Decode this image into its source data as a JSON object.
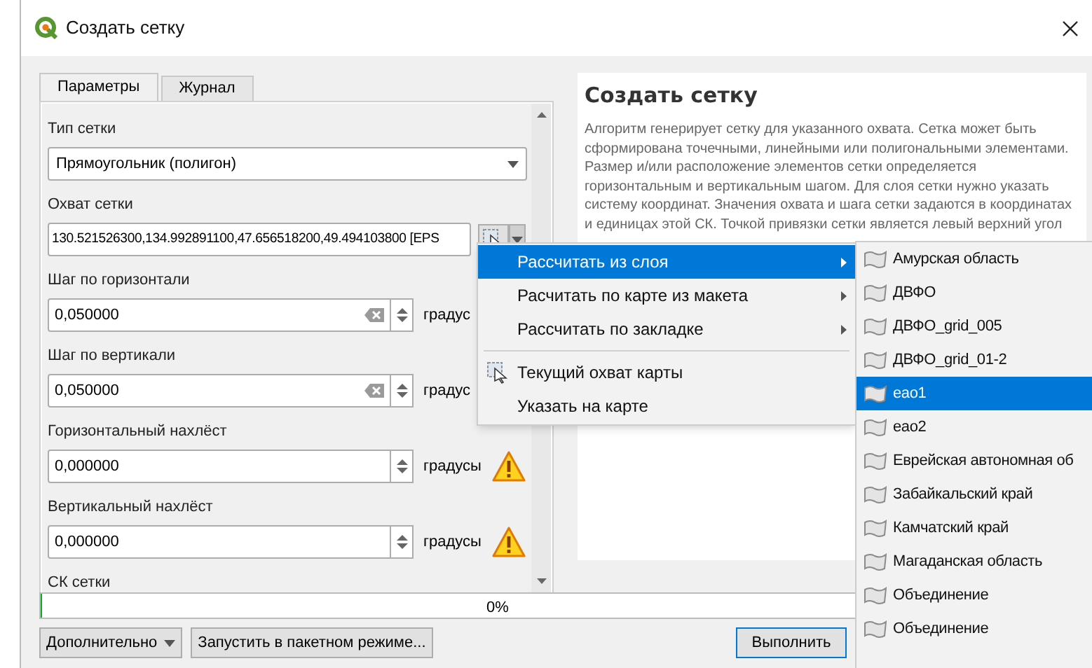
{
  "window": {
    "title": "Создать сетку"
  },
  "tabs": [
    {
      "label": "Параметры",
      "selected": true
    },
    {
      "label": "Журнал",
      "selected": false
    }
  ],
  "fields": [
    {
      "kind": "combo",
      "label": "Тип сетки",
      "value": "Прямоугольник (полигон)"
    },
    {
      "kind": "extent",
      "label": "Охват сетки",
      "value": "130.521526300,134.992891100,47.656518200,49.494103800 [EPS"
    },
    {
      "kind": "spin",
      "label": "Шаг по горизонтали",
      "value": "0,050000",
      "unit": "градус",
      "clearable": true,
      "warning": false
    },
    {
      "kind": "spin",
      "label": "Шаг по вертикали",
      "value": "0,050000",
      "unit": "градус",
      "clearable": true,
      "warning": false
    },
    {
      "kind": "spin",
      "label": "Горизонтальный нахлёст",
      "value": "0,000000",
      "unit": "градусы",
      "clearable": false,
      "warning": true
    },
    {
      "kind": "spin",
      "label": "Вертикальный нахлёст",
      "value": "0,000000",
      "unit": "градусы",
      "clearable": false,
      "warning": true
    },
    {
      "kind": "label",
      "label": "СК сетки"
    }
  ],
  "help": {
    "title": "Создать сетку",
    "text": "Алгоритм генерирует сетку для указанного охвата. Сетка может быть сформирована точечными, линейными или полигональными элементами. Размер и/или расположение элементов сетки определяется горизонтальным и вертикальным шагом. Для слоя сетки нужно указать систему координат. Значения охвата и шага сетки задаются в координатах и единицах этой СК. Точкой привязки сетки является левый верхний угол"
  },
  "progress": {
    "level": 0,
    "reading": "0%"
  },
  "buttons": {
    "advanced": "Дополнительно",
    "batch": "Запустить в пакетном режиме...",
    "run": "Выполнить"
  },
  "menu": [
    {
      "kind": "item",
      "label": "Рассчитать из слоя",
      "submenu": true,
      "icon": false,
      "selected": true
    },
    {
      "kind": "item",
      "label": "Расчитать по карте из макета",
      "submenu": true,
      "icon": false,
      "selected": false
    },
    {
      "kind": "item",
      "label": "Рассчитать по закладке",
      "submenu": true,
      "icon": false,
      "selected": false
    },
    {
      "kind": "separator"
    },
    {
      "kind": "item",
      "label": "Текущий охват карты",
      "submenu": false,
      "icon": true,
      "selected": false
    },
    {
      "kind": "item",
      "label": "Указать на карте",
      "submenu": false,
      "icon": false,
      "selected": false
    }
  ],
  "layers": [
    {
      "label": "Амурская область",
      "selected": false
    },
    {
      "label": "ДВФО",
      "selected": false
    },
    {
      "label": "ДВФО_grid_005",
      "selected": false
    },
    {
      "label": "ДВФО_grid_01-2",
      "selected": false
    },
    {
      "label": "eao1",
      "selected": true
    },
    {
      "label": "eao2",
      "selected": false
    },
    {
      "label": "Еврейская автономная об",
      "selected": false
    },
    {
      "label": "Забайкальский край",
      "selected": false
    },
    {
      "label": "Камчатский край",
      "selected": false
    },
    {
      "label": "Магаданская область",
      "selected": false
    },
    {
      "label": "Объединение",
      "selected": false
    },
    {
      "label": "Объединение",
      "selected": false
    }
  ]
}
